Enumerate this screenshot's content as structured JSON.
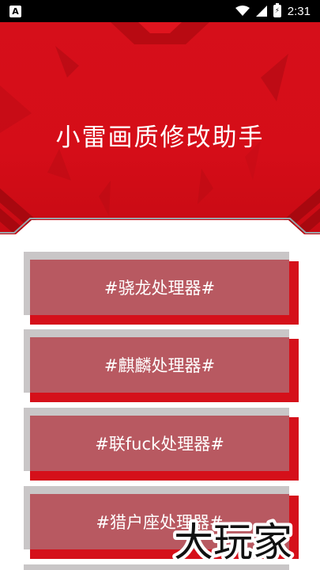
{
  "status_bar": {
    "notification_icon_letter": "A",
    "time": "2:31",
    "battery_glyph": "⚡"
  },
  "header": {
    "title": "小雷画质修改助手"
  },
  "processors": [
    {
      "label": "#骁龙处理器#"
    },
    {
      "label": "#麒麟处理器#"
    },
    {
      "label": "#联fuck处理器#"
    },
    {
      "label": "#猎户座处理器#"
    }
  ],
  "watermark": {
    "text": "大玩家"
  },
  "colors": {
    "brand_red": "#d60f1a",
    "button_face": "#b85961",
    "button_shadow_gray": "#c9c6c7",
    "button_shadow_red": "#d5101a"
  }
}
